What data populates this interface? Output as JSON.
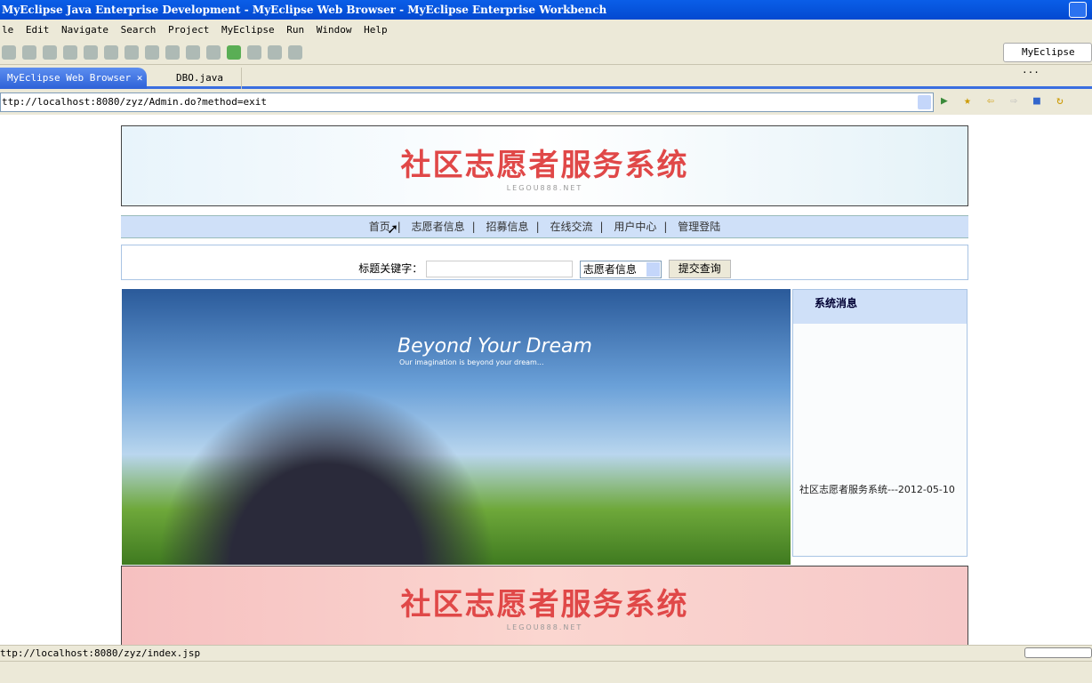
{
  "window": {
    "title": "MyEclipse Java Enterprise Development - MyEclipse Web Browser - MyEclipse Enterprise Workbench"
  },
  "menu": [
    "le",
    "Edit",
    "Navigate",
    "Search",
    "Project",
    "MyEclipse",
    "Run",
    "Window",
    "Help"
  ],
  "perspective": "MyEclipse ...",
  "tabs": [
    {
      "label": "MyEclipse Web Browser",
      "close": "✕"
    },
    {
      "label": "DBO.java"
    }
  ],
  "address": "ttp://localhost:8080/zyz/Admin.do?method=exit",
  "page": {
    "banner_title": "社区志愿者服务系统",
    "banner_sub": "LEGOU888.NET",
    "nav": [
      "首页",
      "志愿者信息",
      "招募信息",
      "在线交流",
      "用户中心",
      "管理登陆"
    ],
    "search": {
      "label": "标题关键字：",
      "value": "",
      "select": "志愿者信息",
      "submit": "提交查询"
    },
    "hero": {
      "title": "Beyond Your Dream",
      "subtitle": "Our imagination is beyond your dream..."
    },
    "sidebar": {
      "title": "系统消息",
      "message": "社区志愿者服务系统---2012-05-10"
    },
    "footer_title": "社区志愿者服务系统",
    "footer_sub": "LEGOU888.NET"
  },
  "status": "ttp://localhost:8080/zyz/index.jsp"
}
